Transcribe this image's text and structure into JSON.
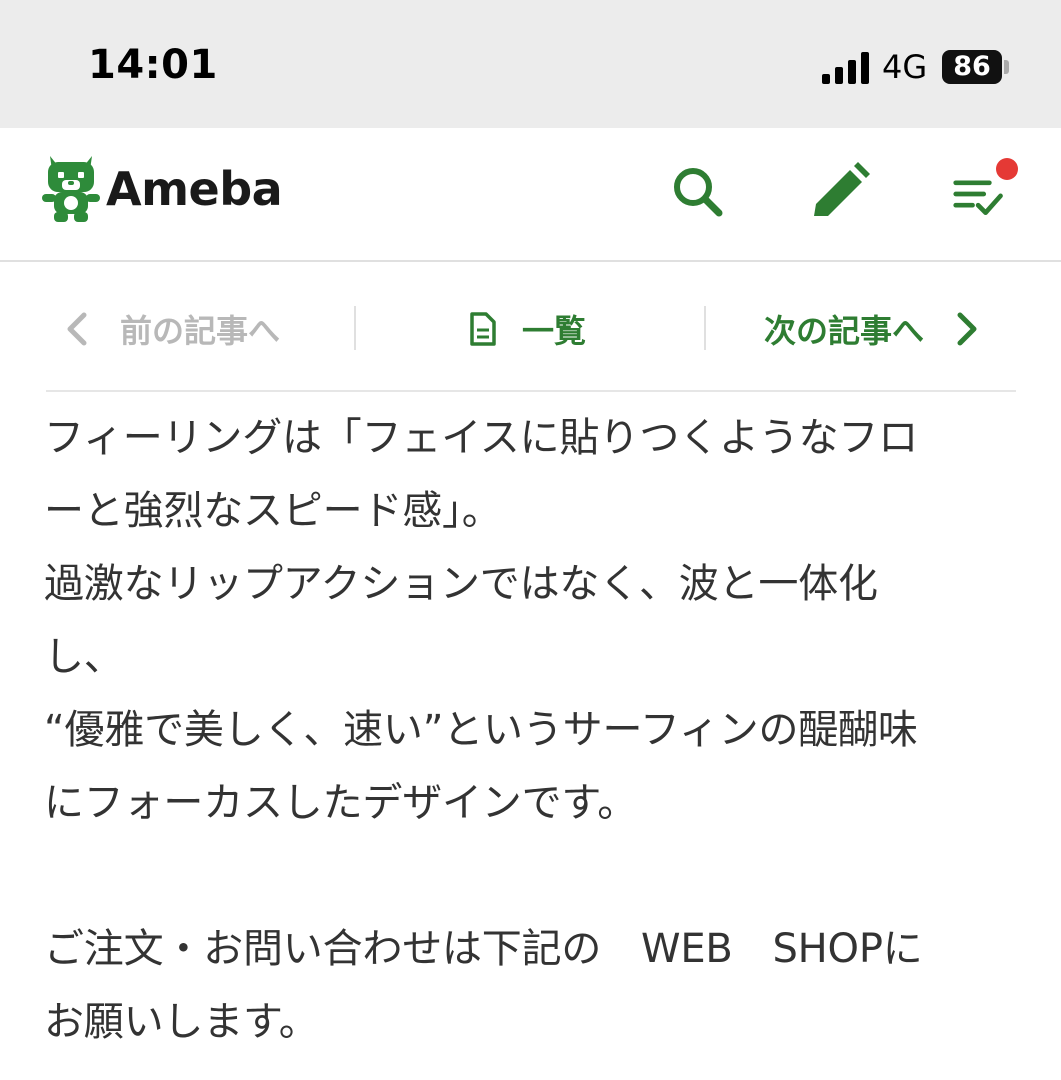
{
  "status_bar": {
    "time": "14:01",
    "network": "4G",
    "battery": "86"
  },
  "header": {
    "logo_text": "Ameba",
    "icons": [
      "search-icon",
      "pencil-icon",
      "reading-list-icon"
    ],
    "accent_color": "#2e7d32",
    "notification_color": "#e53935"
  },
  "article_nav": {
    "prev_label": "前の記事へ",
    "list_label": "一覧",
    "next_label": "次の記事へ"
  },
  "article": {
    "lines": [
      "フィーリングは「フェイスに貼りつくようなフロ",
      "ーと強烈なスピード感」。",
      "過激なリップアクションではなく、波と一体化",
      "し、",
      "“優雅で美しく、速い”というサーフィンの醍醐味",
      "にフォーカスしたデザインです。",
      "ご注文・お問い合わせは下記の　WEB　SHOPに",
      "お願いします。"
    ]
  }
}
